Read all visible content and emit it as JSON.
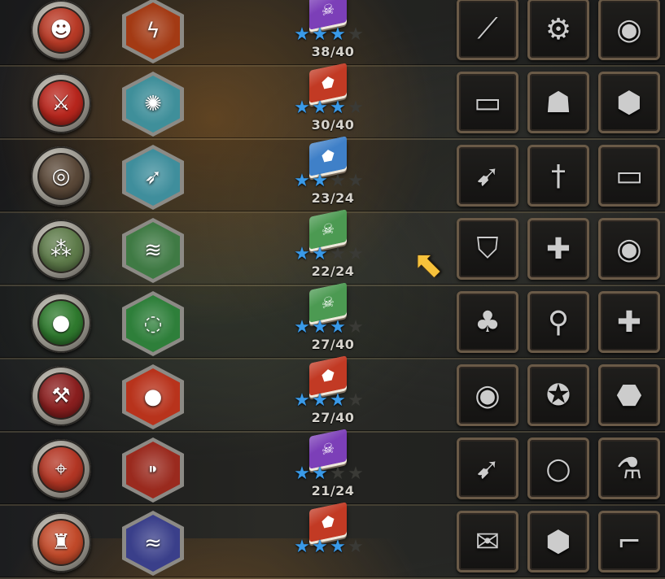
{
  "rows": [
    {
      "hero": {
        "icon": "mutant-face-icon",
        "glyph": "☻",
        "bg": "#b83a26"
      },
      "skill": {
        "icon": "lightning-crack-icon",
        "glyph": "ϟ",
        "bg": "#a33a14"
      },
      "book": {
        "color": "#7c3fb8",
        "icon": "skull-icon",
        "glyph": "☠"
      },
      "stars_filled": 3,
      "stars_total": 4,
      "progress": "38/40",
      "equipment": [
        {
          "icon": "spear-icon",
          "glyph": "⟋"
        },
        {
          "icon": "golden-gear-icon",
          "glyph": "⚙"
        },
        {
          "icon": "steel-bracer-icon",
          "glyph": "◉"
        }
      ]
    },
    {
      "hero": {
        "icon": "sword-emblem-icon",
        "glyph": "⚔",
        "bg": "#b8261d"
      },
      "skill": {
        "icon": "energy-orb-icon",
        "glyph": "✺",
        "bg": "#3f8f9a"
      },
      "book": {
        "color": "#c23a24",
        "icon": "shield-emblem-icon",
        "glyph": "⬟"
      },
      "stars_filled": 3,
      "stars_total": 4,
      "progress": "30/40",
      "equipment": [
        {
          "icon": "rune-tablet-icon",
          "glyph": "▭"
        },
        {
          "icon": "red-hood-icon",
          "glyph": "☗"
        },
        {
          "icon": "red-crystal-icon",
          "glyph": "⬢"
        }
      ]
    },
    {
      "hero": {
        "icon": "metal-cog-ring-icon",
        "glyph": "◎",
        "bg": "#5a4838"
      },
      "skill": {
        "icon": "missile-barrage-icon",
        "glyph": "➶",
        "bg": "#3f8e9c"
      },
      "book": {
        "color": "#3f80c8",
        "icon": "shield-emblem-icon",
        "glyph": "⬟"
      },
      "stars_filled": 2,
      "stars_total": 4,
      "progress": "23/24",
      "equipment": [
        {
          "icon": "rocket-boot-icon",
          "glyph": "➹"
        },
        {
          "icon": "golden-sword-icon",
          "glyph": "†"
        },
        {
          "icon": "rune-tablet-icon",
          "glyph": "▭"
        }
      ]
    },
    {
      "hero": {
        "icon": "green-claw-icon",
        "glyph": "⁂",
        "bg": "#5e7b4a"
      },
      "skill": {
        "icon": "green-vortex-icon",
        "glyph": "≋",
        "bg": "#3f7a44"
      },
      "book": {
        "color": "#4c9a52",
        "icon": "skull-icon",
        "glyph": "☠"
      },
      "stars_filled": 2,
      "stars_total": 4,
      "progress": "22/24",
      "equipment": [
        {
          "icon": "blue-shield-icon",
          "glyph": "⛉"
        },
        {
          "icon": "medkit-icon",
          "glyph": "✚"
        },
        {
          "icon": "steel-bracer-icon",
          "glyph": "◉"
        }
      ]
    },
    {
      "hero": {
        "icon": "green-slime-icon",
        "glyph": "●",
        "bg": "#2f7a2e"
      },
      "skill": {
        "icon": "green-swirl-icon",
        "glyph": "◌",
        "bg": "#2e7f3a"
      },
      "book": {
        "color": "#4c9a52",
        "icon": "skull-icon",
        "glyph": "☠"
      },
      "stars_filled": 3,
      "stars_total": 4,
      "progress": "27/40",
      "equipment": [
        {
          "icon": "golden-clover-icon",
          "glyph": "♣"
        },
        {
          "icon": "broom-icon",
          "glyph": "⚲"
        },
        {
          "icon": "medkit-icon",
          "glyph": "✚"
        }
      ]
    },
    {
      "hero": {
        "icon": "battle-axe-icon",
        "glyph": "⚒",
        "bg": "#8a1f1f"
      },
      "skill": {
        "icon": "bomb-icon",
        "glyph": "●",
        "bg": "#b8331c"
      },
      "book": {
        "color": "#c23a24",
        "icon": "shield-emblem-icon",
        "glyph": "⬟"
      },
      "stars_filled": 3,
      "stars_total": 4,
      "progress": "27/40",
      "equipment": [
        {
          "icon": "steel-bracer-icon",
          "glyph": "◉"
        },
        {
          "icon": "spellbook-icon",
          "glyph": "✪"
        },
        {
          "icon": "gold-nugget-icon",
          "glyph": "⬣"
        }
      ]
    },
    {
      "hero": {
        "icon": "target-crosshair-icon",
        "glyph": "⌖",
        "bg": "#b33624"
      },
      "skill": {
        "icon": "bullets-icon",
        "glyph": "⁍",
        "bg": "#9a2a1e"
      },
      "book": {
        "color": "#7c3fb8",
        "icon": "skull-icon",
        "glyph": "☠"
      },
      "stars_filled": 2,
      "stars_total": 4,
      "progress": "21/24",
      "equipment": [
        {
          "icon": "rocket-boot-icon",
          "glyph": "➹"
        },
        {
          "icon": "bronze-ring-icon",
          "glyph": "○"
        },
        {
          "icon": "green-potion-icon",
          "glyph": "⚗"
        }
      ]
    },
    {
      "hero": {
        "icon": "top-hat-icon",
        "glyph": "♜",
        "bg": "#c24a2a"
      },
      "skill": {
        "icon": "tornado-icon",
        "glyph": "≈",
        "bg": "#3a3f8a"
      },
      "book": {
        "color": "#c23a24",
        "icon": "shield-emblem-icon",
        "glyph": "⬟"
      },
      "stars_filled": 3,
      "stars_total": 4,
      "progress": "",
      "equipment": [
        {
          "icon": "scroll-icon",
          "glyph": "✉"
        },
        {
          "icon": "red-crystal-icon",
          "glyph": "⬢"
        },
        {
          "icon": "hook-icon",
          "glyph": "⌐"
        }
      ]
    }
  ],
  "cursor": {
    "icon": "pointer-arrow-icon",
    "glyph": "⬆",
    "color": "#f7c23b"
  }
}
